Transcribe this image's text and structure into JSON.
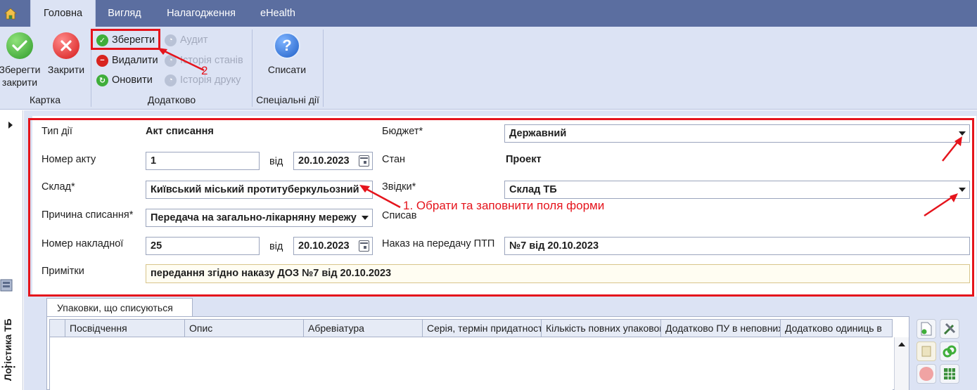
{
  "tabs": [
    {
      "label": "Головна",
      "active": true
    },
    {
      "label": "Вигляд",
      "active": false
    },
    {
      "label": "Налагодження",
      "active": false
    },
    {
      "label": "eHealth",
      "active": false
    }
  ],
  "ribbon": {
    "card_group": {
      "label": "Картка",
      "save_close_label": "Зберегти закрити",
      "close_label": "Закрити"
    },
    "extra_group": {
      "label": "Додатково",
      "save_label": "Зберегти",
      "delete_label": "Видалити",
      "refresh_label": "Оновити",
      "audit_label": "Аудит",
      "state_history_label": "Історія станів",
      "print_history_label": "Історія друку"
    },
    "special_group": {
      "label": "Спеціальні дії",
      "write_off_label": "Списати"
    }
  },
  "left_panel": {
    "title": "Логістика ТБ"
  },
  "form": {
    "action_type_label": "Тип дії",
    "action_type_value": "Акт списання",
    "budget_label": "Бюджет*",
    "budget_value": "Державний",
    "act_number_label": "Номер акту",
    "act_number_value": "1",
    "from_label_1": "від",
    "act_date_value": "20.10.2023",
    "state_label": "Стан",
    "state_value": "Проект",
    "warehouse_label": "Склад*",
    "warehouse_value": "Київський міський протитуберкульозний",
    "source_label": "Звідки*",
    "source_value": "Склад ТБ",
    "reason_label": "Причина списання*",
    "reason_value": "Передача на загально-лікарняну мережу",
    "written_off_label": "Списав",
    "invoice_number_label": "Номер накладної",
    "invoice_number_value": "25",
    "from_label_2": "від",
    "invoice_date_value": "20.10.2023",
    "order_label": "Наказ на передачу ПТП",
    "order_value": "№7 від 20.10.2023",
    "notes_label": "Примітки",
    "notes_value": "передання згідно наказу ДОЗ №7 від 20.10.2023"
  },
  "annotations": {
    "step1": "1. Обрати та заповнити поля форми",
    "step2": "2"
  },
  "packages": {
    "tab_label": "Упаковки, що списуються",
    "columns": [
      "Посвідчення",
      "Опис",
      "Абревіатура",
      "Серія, термін придатності",
      "Кількість повних упаковок",
      "Додатково ПУ в неповних",
      "Додатково одиниць в"
    ],
    "rows": []
  },
  "colors": {
    "tab_bar": "#5b6ea0",
    "ribbon_bg": "#dce3f4",
    "highlight_red": "#e5141c"
  }
}
